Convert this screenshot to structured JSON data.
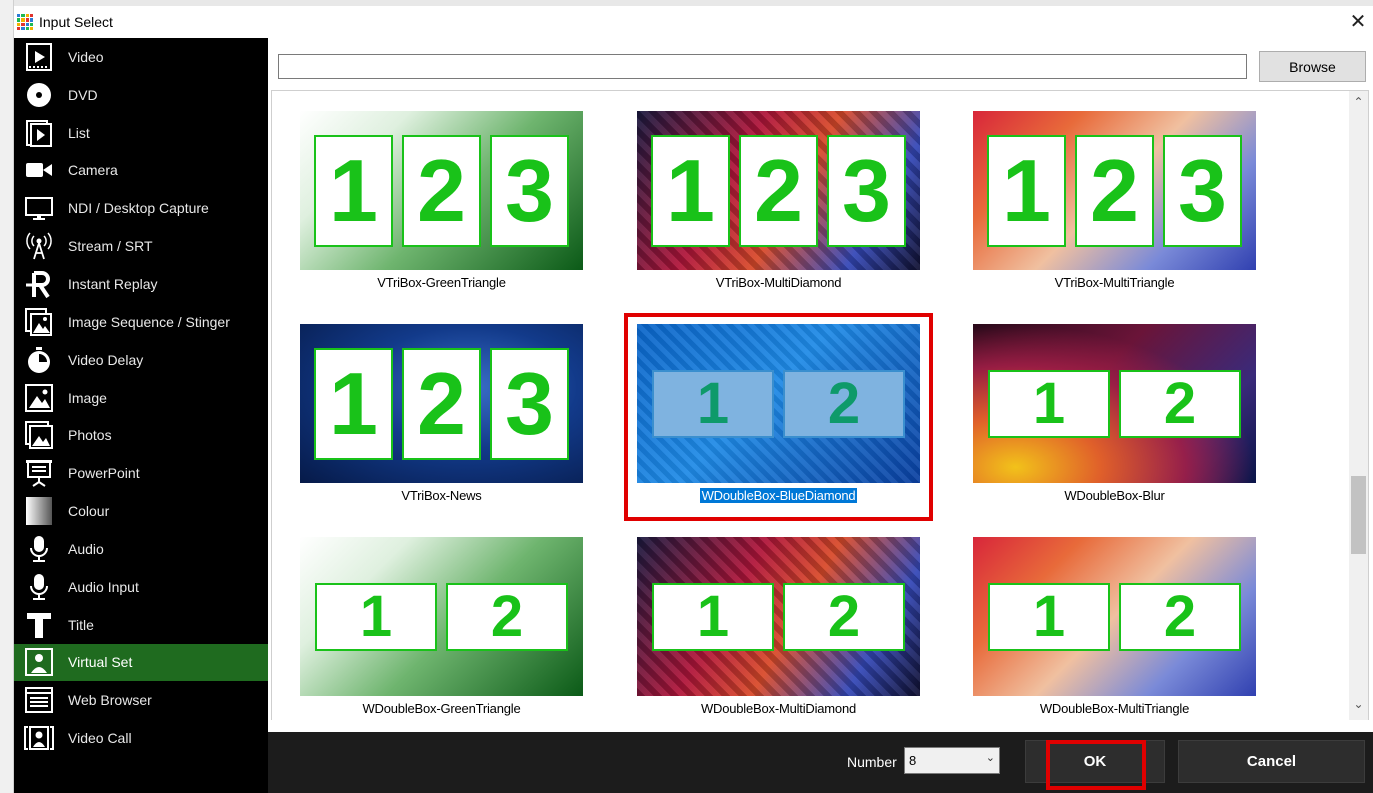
{
  "window": {
    "title": "Input Select",
    "close_icon": "close-icon",
    "app_icon": "vmix-grid-icon",
    "app_icon_colors": [
      "#2b7bd6",
      "#1db954",
      "#f2b100",
      "#e0322e"
    ]
  },
  "sidebar": {
    "active_color": "#1f6b1f",
    "items": [
      {
        "label": "Video",
        "icon": "video-icon"
      },
      {
        "label": "DVD",
        "icon": "disc-icon"
      },
      {
        "label": "List",
        "icon": "list-icon"
      },
      {
        "label": "Camera",
        "icon": "camera-icon"
      },
      {
        "label": "NDI / Desktop Capture",
        "icon": "monitor-icon"
      },
      {
        "label": "Stream / SRT",
        "icon": "antenna-icon"
      },
      {
        "label": "Instant Replay",
        "icon": "replay-icon"
      },
      {
        "label": "Image Sequence / Stinger",
        "icon": "image-sequence-icon"
      },
      {
        "label": "Video Delay",
        "icon": "stopwatch-icon"
      },
      {
        "label": "Image",
        "icon": "image-icon"
      },
      {
        "label": "Photos",
        "icon": "photos-icon"
      },
      {
        "label": "PowerPoint",
        "icon": "presentation-icon"
      },
      {
        "label": "Colour",
        "icon": "colour-gradient-icon"
      },
      {
        "label": "Audio",
        "icon": "microphone-icon"
      },
      {
        "label": "Audio Input",
        "icon": "microphone-icon"
      },
      {
        "label": "Title",
        "icon": "title-t-icon"
      },
      {
        "label": "Virtual Set",
        "icon": "virtual-set-icon",
        "active": true
      },
      {
        "label": "Web Browser",
        "icon": "browser-icon"
      },
      {
        "label": "Video Call",
        "icon": "video-call-icon"
      }
    ]
  },
  "path_bar": {
    "value": "",
    "browse_label": "Browse"
  },
  "grid": {
    "tiles": [
      {
        "label": "VTriBox-GreenTriangle",
        "layout": "tri",
        "numbers": [
          "1",
          "2",
          "3"
        ],
        "bg": "green"
      },
      {
        "label": "VTriBox-MultiDiamond",
        "layout": "tri",
        "numbers": [
          "1",
          "2",
          "3"
        ],
        "bg": "multidiamond"
      },
      {
        "label": "VTriBox-MultiTriangle",
        "layout": "tri",
        "numbers": [
          "1",
          "2",
          "3"
        ],
        "bg": "multitriangle"
      },
      {
        "label": "VTriBox-News",
        "layout": "tri",
        "numbers": [
          "1",
          "2",
          "3"
        ],
        "bg": "news"
      },
      {
        "label": "WDoubleBox-BlueDiamond",
        "layout": "dbl",
        "numbers": [
          "1",
          "2"
        ],
        "bg": "bluediamond",
        "selected": true
      },
      {
        "label": "WDoubleBox-Blur",
        "layout": "dbl",
        "numbers": [
          "1",
          "2"
        ],
        "bg": "blur"
      },
      {
        "label": "WDoubleBox-GreenTriangle",
        "layout": "dbl",
        "numbers": [
          "1",
          "2"
        ],
        "bg": "green"
      },
      {
        "label": "WDoubleBox-MultiDiamond",
        "layout": "dbl",
        "numbers": [
          "1",
          "2"
        ],
        "bg": "multidiamond"
      },
      {
        "label": "WDoubleBox-MultiTriangle",
        "layout": "dbl",
        "numbers": [
          "1",
          "2"
        ],
        "bg": "multitriangle"
      }
    ]
  },
  "scrollbar": {
    "up_icon": "scroll-up-arrow-icon",
    "down_icon": "scroll-down-arrow-icon"
  },
  "footer": {
    "number_label": "Number",
    "number_value": "8",
    "ok_label": "OK",
    "cancel_label": "Cancel",
    "highlight_color": "#e00000"
  }
}
